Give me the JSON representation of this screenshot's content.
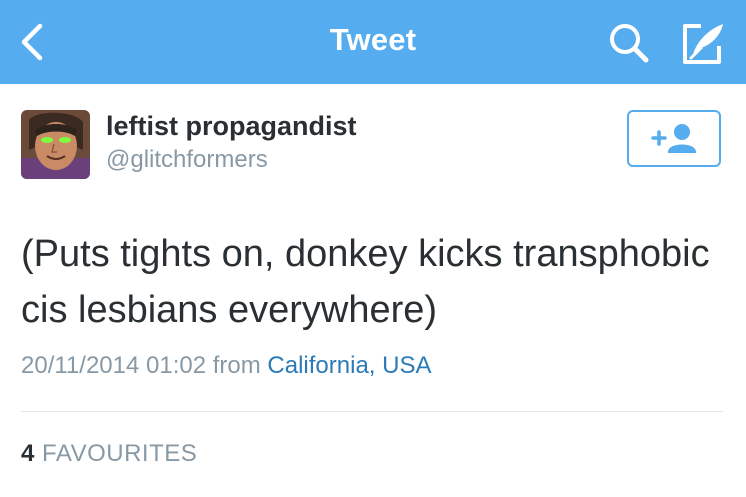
{
  "colors": {
    "nav_background": "#55acee",
    "accent": "#55acee",
    "link": "#2b7bb9",
    "primary_text": "#292f33",
    "secondary_text": "#8899a6",
    "divider": "#e1e8ed"
  },
  "navbar": {
    "title": "Tweet",
    "icons": [
      "chevron-left-icon",
      "search-icon",
      "compose-icon"
    ]
  },
  "tweet": {
    "author": {
      "display_name": "leftist propagandist",
      "handle": "@glitchformers",
      "avatar_icon": "avatar"
    },
    "follow_icon": "add-user-icon",
    "text": "(Puts tights on, donkey kicks transphobic cis lesbians everywhere)",
    "timestamp": "20/11/2014 01:02",
    "from_label": "from",
    "location": "California, USA"
  },
  "stats": {
    "favourites_count": "4",
    "favourites_label": "FAVOURITES"
  }
}
